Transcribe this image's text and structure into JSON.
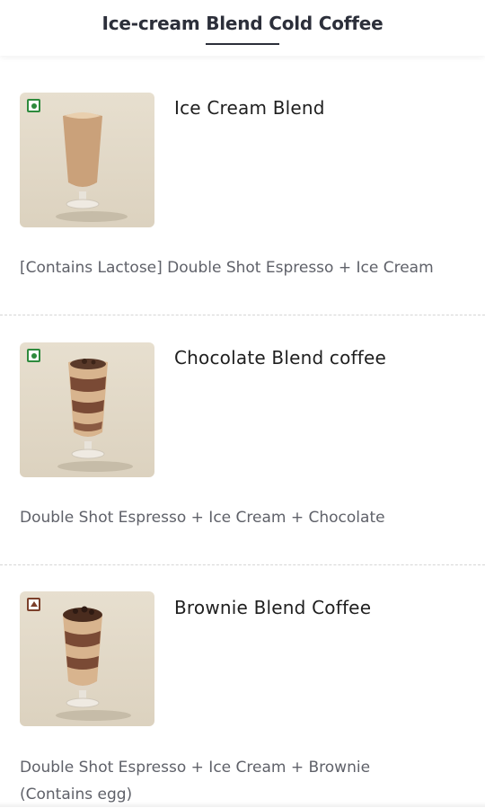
{
  "header": {
    "title": "Ice-cream Blend Cold Coffee"
  },
  "items": [
    {
      "name": "Ice Cream Blend",
      "description": "[Contains Lactose] Double Shot Espresso + Ice Cream",
      "diet_mark": "veg-mark-icon"
    },
    {
      "name": "Chocolate Blend coffee",
      "description": "Double Shot Espresso + Ice Cream + Chocolate",
      "diet_mark": "veg-mark-icon"
    },
    {
      "name": "Brownie Blend Coffee",
      "description_line1": "Double Shot Espresso + Ice Cream + Brownie",
      "description_line2": "(Contains egg)",
      "diet_mark": "non-veg-mark-icon"
    }
  ],
  "colors": {
    "veg": "#2e8a3d",
    "non_veg": "#7b3f2a",
    "title": "#2c2f3a",
    "description": "#5f6169"
  }
}
